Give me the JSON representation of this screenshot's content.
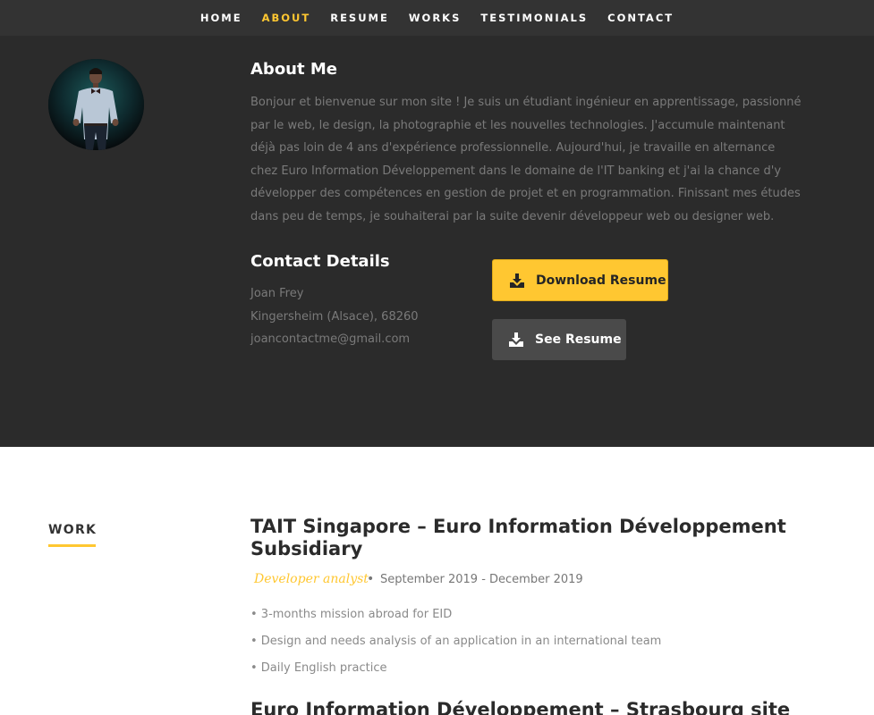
{
  "nav": {
    "items": [
      {
        "label": "HOME"
      },
      {
        "label": "ABOUT"
      },
      {
        "label": "RESUME"
      },
      {
        "label": "WORKS"
      },
      {
        "label": "TESTIMONIALS"
      },
      {
        "label": "CONTACT"
      }
    ],
    "active_index": 1
  },
  "about": {
    "avatar_icon": "profile-photo",
    "title": "About Me",
    "text": "Bonjour et bienvenue sur mon site ! Je suis un étudiant ingénieur en apprentissage, passionné par le web, le design, la photographie et les nouvelles technologies. J'accumule maintenant déjà pas loin de 4 ans d'expérience professionnelle. Aujourd'hui, je travaille en alternance chez Euro Information Développement dans le domaine de l'IT banking et j'ai la chance d'y développer des compétences en gestion de projet et en programmation. Finissant mes études dans peu de temps, je souhaiterai par la suite devenir développeur web ou designer web."
  },
  "contact": {
    "title": "Contact Details",
    "name": "Joan Frey",
    "location": "Kingersheim (Alsace), 68260",
    "email": "joancontactme@gmail.com"
  },
  "buttons": {
    "download_label": "Download Resume",
    "see_label": "See Resume",
    "icon": "download-icon"
  },
  "work": {
    "section_label": "WORK",
    "jobs": [
      {
        "title": "TAIT Singapore – Euro Information Développement Subsidiary",
        "role": "Developer analyst",
        "separator": "•",
        "dates": "September 2019 - December 2019",
        "bullets": [
          "• 3-months mission abroad for EID",
          "• Design and needs analysis of an application in an international team",
          "• Daily English practice"
        ]
      },
      {
        "title": "Euro Information Développement – Strasbourg site"
      }
    ]
  },
  "colors": {
    "accent": "#ffc731",
    "nav_bg": "#333333",
    "about_bg": "#2b2b2b",
    "muted_text": "#7a7a7a"
  }
}
